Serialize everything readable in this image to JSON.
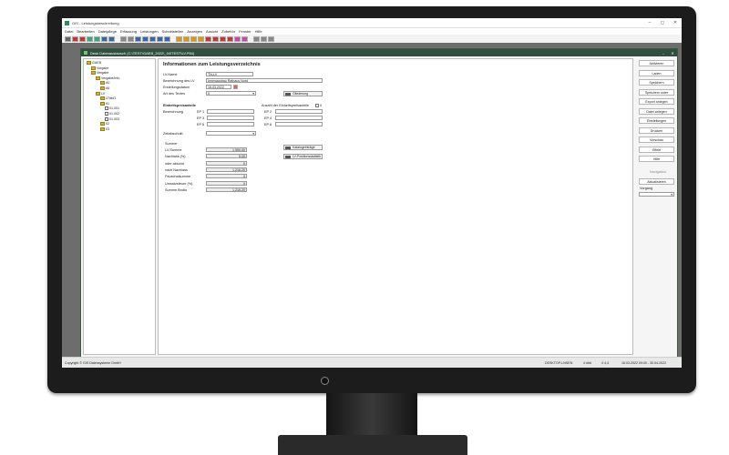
{
  "window": {
    "title": "GIS - Leistungsbeschreibung",
    "controls": [
      "–",
      "◻",
      "✕"
    ]
  },
  "menu": [
    "Datei",
    "Bearbeiten",
    "Dateipflege",
    "Erfassung",
    "Leistungen",
    "Schnittstellen",
    "Anzeigen",
    "Ansicht",
    "Zubehör",
    "Fenster",
    "Hilfe"
  ],
  "child_window": {
    "title": "Desk Datenaustausch (C:\\TEST\\GAEB_2022\\_04\\TEST\\LV.P84)",
    "controls": [
      "–",
      "✕"
    ]
  },
  "tree": [
    {
      "label": "GAEB",
      "indent": 0
    },
    {
      "label": "Vorgabe",
      "indent": 1
    },
    {
      "label": "Vergabe",
      "indent": 1
    },
    {
      "label": "Vergabe/Info",
      "indent": 2
    },
    {
      "label": "A0",
      "indent": 3
    },
    {
      "label": "A6",
      "indent": 3
    },
    {
      "label": "LV",
      "indent": 2
    },
    {
      "label": "LTitel/1",
      "indent": 3
    },
    {
      "label": "01",
      "indent": 3
    },
    {
      "label": "01.001",
      "indent": 4
    },
    {
      "label": "01.002",
      "indent": 4
    },
    {
      "label": "01.003",
      "indent": 4
    },
    {
      "label": "02",
      "indent": 3
    },
    {
      "label": "03",
      "indent": 3
    }
  ],
  "form": {
    "heading": "Informationen zum Leistungsverzeichnis",
    "kurzname_label": "LV-Name",
    "kurzname_value": "TN-LV",
    "bezeichnung_label": "Bezeichnung des LV",
    "bezeichnung_value": "Innenausbau Rathaus Nord",
    "datum_label": "Erstellungsdatum",
    "datum_value": "16.03.2022",
    "typ_label": "Art des Textes",
    "typ_value": "0",
    "gliederung_button": "Gliederung",
    "einheit_heading": "Einheitspreisanteile",
    "anzahl_label": "Anzahl der Einheitspreisanteile",
    "anzahl_value": "0",
    "bez_label": "Bezeichnung",
    "ep1": "EP 1",
    "ep2": "EP 2",
    "ep3": "EP 3",
    "ep4": "EP 4",
    "ep5": "EP 5",
    "ep6": "EP 6",
    "waehrung_label": "Zeitabschnitt",
    "summe_heading": "Summe",
    "summen": [
      {
        "label": "LV-Summe",
        "value": "1.590,00"
      },
      {
        "label": "Nachlass (%)",
        "value": "5,00"
      },
      {
        "label": "oder absolut",
        "value": "0"
      },
      {
        "label": "nach Nachlass",
        "value": "1.216,20"
      },
      {
        "label": "Pauschalsumme",
        "value": "0"
      },
      {
        "label": "Umsatzsteuer (%)",
        "value": "0"
      },
      {
        "label": "Summe Brutto",
        "value": "1.216,20"
      }
    ],
    "katalog_button": "Katalogeinträge",
    "positionen_button": "LV-Positionsstatistik"
  },
  "right_buttons": [
    "Aktivieren",
    "Laden",
    "Speichern",
    "Speichern unter",
    "Export anlegen",
    "Datei anlegen",
    "Einstellungen",
    "Drucken",
    "Vorschau",
    "Effekt",
    "Hilfe"
  ],
  "right_lower": {
    "label1": "Navigation",
    "button": "Aktualisieren",
    "vorgang_label": "Vorgang",
    "vorgang_value": ""
  },
  "status": {
    "left": "Copyright © GIS Datensysteme GmbH",
    "right": [
      "DESKTOP-LNSEN",
      "4 ###",
      "4 4,4",
      "16.03.2022 09:00 - 30.04.2022"
    ]
  },
  "colors": {
    "title_bar": "#2f4f3f",
    "workspace": "#6d6d6d"
  }
}
